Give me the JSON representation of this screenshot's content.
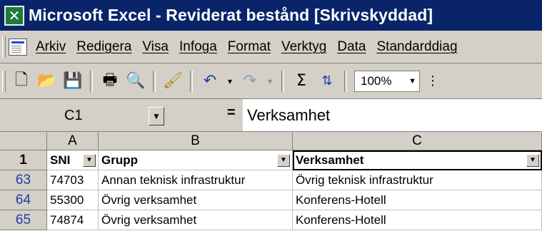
{
  "window": {
    "title": "Microsoft Excel - Reviderat bestånd  [Skrivskyddad]",
    "app_icon": "excel-icon"
  },
  "menu": [
    "Arkiv",
    "Redigera",
    "Visa",
    "Infoga",
    "Format",
    "Verktyg",
    "Data",
    "Standarddiag"
  ],
  "toolbar": {
    "zoom": "100%"
  },
  "formula_bar": {
    "cell_ref": "C1",
    "equals": "=",
    "value": "Verksamhet"
  },
  "columns": [
    "A",
    "B",
    "C"
  ],
  "header_row": {
    "number": "1",
    "a": "SNI",
    "b": "Grupp",
    "c": "Verksamhet"
  },
  "rows": [
    {
      "number": "63",
      "a": "74703",
      "b": "Annan teknisk infrastruktur",
      "c": "Övrig teknisk infrastruktur"
    },
    {
      "number": "64",
      "a": "55300",
      "b": "Övrig verksamhet",
      "c": "Konferens-Hotell"
    },
    {
      "number": "65",
      "a": "74874",
      "b": "Övrig verksamhet",
      "c": "Konferens-Hotell"
    }
  ]
}
